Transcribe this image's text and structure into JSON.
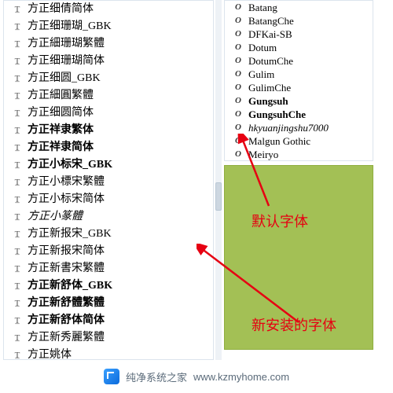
{
  "left_fonts": [
    {
      "label": "方正细倩简体",
      "style": ""
    },
    {
      "label": "方正细珊瑚_GBK",
      "style": ""
    },
    {
      "label": "方正細珊瑚繁體",
      "style": ""
    },
    {
      "label": "方正细珊瑚简体",
      "style": ""
    },
    {
      "label": "方正细圆_GBK",
      "style": ""
    },
    {
      "label": "方正細圓繁體",
      "style": ""
    },
    {
      "label": "方正细圆简体",
      "style": ""
    },
    {
      "label": "方正祥隶繁体",
      "style": "bold"
    },
    {
      "label": "方正祥隶简体",
      "style": "bold"
    },
    {
      "label": "方正小标宋_GBK",
      "style": "bold"
    },
    {
      "label": "方正小標宋繁體",
      "style": ""
    },
    {
      "label": "方正小标宋简体",
      "style": ""
    },
    {
      "label": "方正小篆體",
      "style": "italic"
    },
    {
      "label": "方正新报宋_GBK",
      "style": ""
    },
    {
      "label": "方正新报宋简体",
      "style": ""
    },
    {
      "label": "方正新書宋繁體",
      "style": ""
    },
    {
      "label": "方正新舒体_GBK",
      "style": "bold"
    },
    {
      "label": "方正新舒體繁體",
      "style": "bold"
    },
    {
      "label": "方正新舒体简体",
      "style": "bold"
    },
    {
      "label": "方正新秀麗繁體",
      "style": ""
    },
    {
      "label": "方正姚体",
      "style": ""
    }
  ],
  "right_fonts": [
    {
      "label": "Batang"
    },
    {
      "label": "BatangChe"
    },
    {
      "label": "DFKai-SB"
    },
    {
      "label": "Dotum"
    },
    {
      "label": "DotumChe"
    },
    {
      "label": "Gulim"
    },
    {
      "label": "GulimChe"
    },
    {
      "label": "Gungsuh",
      "bold": true
    },
    {
      "label": "GungsuhChe",
      "bold": true
    },
    {
      "label": "hkyuanjingshu7000",
      "italic": true
    },
    {
      "label": "Malgun Gothic"
    },
    {
      "label": "Meiryo"
    }
  ],
  "annotations": {
    "default": "默认字体",
    "new_installed": "新安装的字体"
  },
  "footer": {
    "site_name": "纯净系统之家",
    "site_url": "www.kzmyhome.com"
  }
}
